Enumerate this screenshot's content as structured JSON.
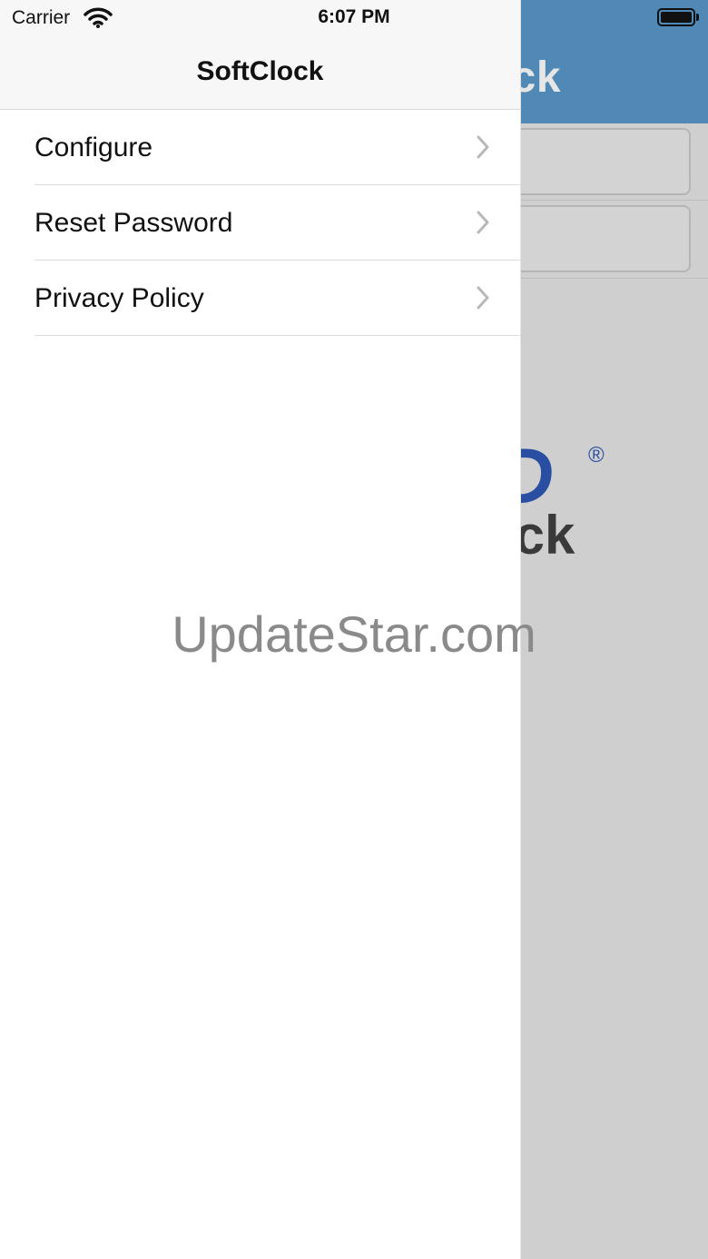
{
  "status_bar": {
    "carrier": "Carrier",
    "time": "6:07 PM"
  },
  "background_app": {
    "header_title": "lock",
    "logo_mark": "D",
    "logo_reg": "®",
    "logo_text": "ock"
  },
  "drawer": {
    "title": "SoftClock",
    "items": [
      {
        "label": "Configure"
      },
      {
        "label": "Reset Password"
      },
      {
        "label": "Privacy Policy"
      }
    ]
  },
  "watermark": "UpdateStar.com",
  "colors": {
    "header_blue": "#5089b6",
    "logo_blue": "#2a4fa2"
  }
}
